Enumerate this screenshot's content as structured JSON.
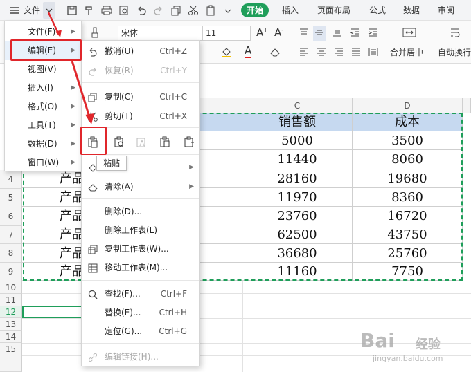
{
  "topbar": {
    "file_label": "文件",
    "tabs": [
      "开始",
      "插入",
      "页面布局",
      "公式",
      "数据",
      "审阅"
    ]
  },
  "ribbon": {
    "font_name": "宋体",
    "font_size": "11",
    "merge_label": "合并居中",
    "wrap_label": "自动换行"
  },
  "sheet": {
    "columns": [
      "C",
      "D"
    ],
    "rows": [
      "4",
      "5",
      "6",
      "7",
      "8",
      "9",
      "10",
      "11",
      "12",
      "13",
      "14",
      "15"
    ],
    "col_a_text": "产品",
    "header": {
      "c": "销售额",
      "d": "成本"
    },
    "data": [
      {
        "c": "5000",
        "d": "3500"
      },
      {
        "c": "11440",
        "d": "8060"
      },
      {
        "c": "28160",
        "d": "19680"
      },
      {
        "c": "11970",
        "d": "8360"
      },
      {
        "c": "23760",
        "d": "16720"
      },
      {
        "c": "62500",
        "d": "43750"
      },
      {
        "c": "36680",
        "d": "25760"
      },
      {
        "c": "11160",
        "d": "7750"
      }
    ]
  },
  "menu_main": {
    "items": [
      {
        "label": "文件(F)"
      },
      {
        "label": "编辑(E)"
      },
      {
        "label": "视图(V)"
      },
      {
        "label": "插入(I)"
      },
      {
        "label": "格式(O)"
      },
      {
        "label": "工具(T)"
      },
      {
        "label": "数据(D)"
      },
      {
        "label": "窗口(W)"
      }
    ]
  },
  "menu_edit": {
    "undo": {
      "label": "撤消(U)",
      "shortcut": "Ctrl+Z"
    },
    "redo": {
      "label": "恢复(R)",
      "shortcut": "Ctrl+Y"
    },
    "copy": {
      "label": "复制(C)",
      "shortcut": "Ctrl+C"
    },
    "cut": {
      "label": "剪切(T)",
      "shortcut": "Ctrl+X"
    },
    "clear": {
      "label": "清除(A)"
    },
    "delete": {
      "label": "删除(D)..."
    },
    "delete_sheet": {
      "label": "删除工作表(L)"
    },
    "copy_sheet": {
      "label": "复制工作表(W)..."
    },
    "move_sheet": {
      "label": "移动工作表(M)..."
    },
    "find": {
      "label": "查找(F)...",
      "shortcut": "Ctrl+F"
    },
    "replace": {
      "label": "替换(E)...",
      "shortcut": "Ctrl+H"
    },
    "goto": {
      "label": "定位(G)...",
      "shortcut": "Ctrl+G"
    },
    "edit_links": {
      "label": "编辑链接(H)..."
    }
  },
  "tooltip": "粘贴",
  "watermark": {
    "logo": "Bai",
    "logo2": "经验",
    "url": "jingyan.baidu.com"
  },
  "colors": {
    "accent": "#1f9e5a",
    "highlight_red": "#e0262b",
    "header_fill": "#c6d9f0"
  }
}
